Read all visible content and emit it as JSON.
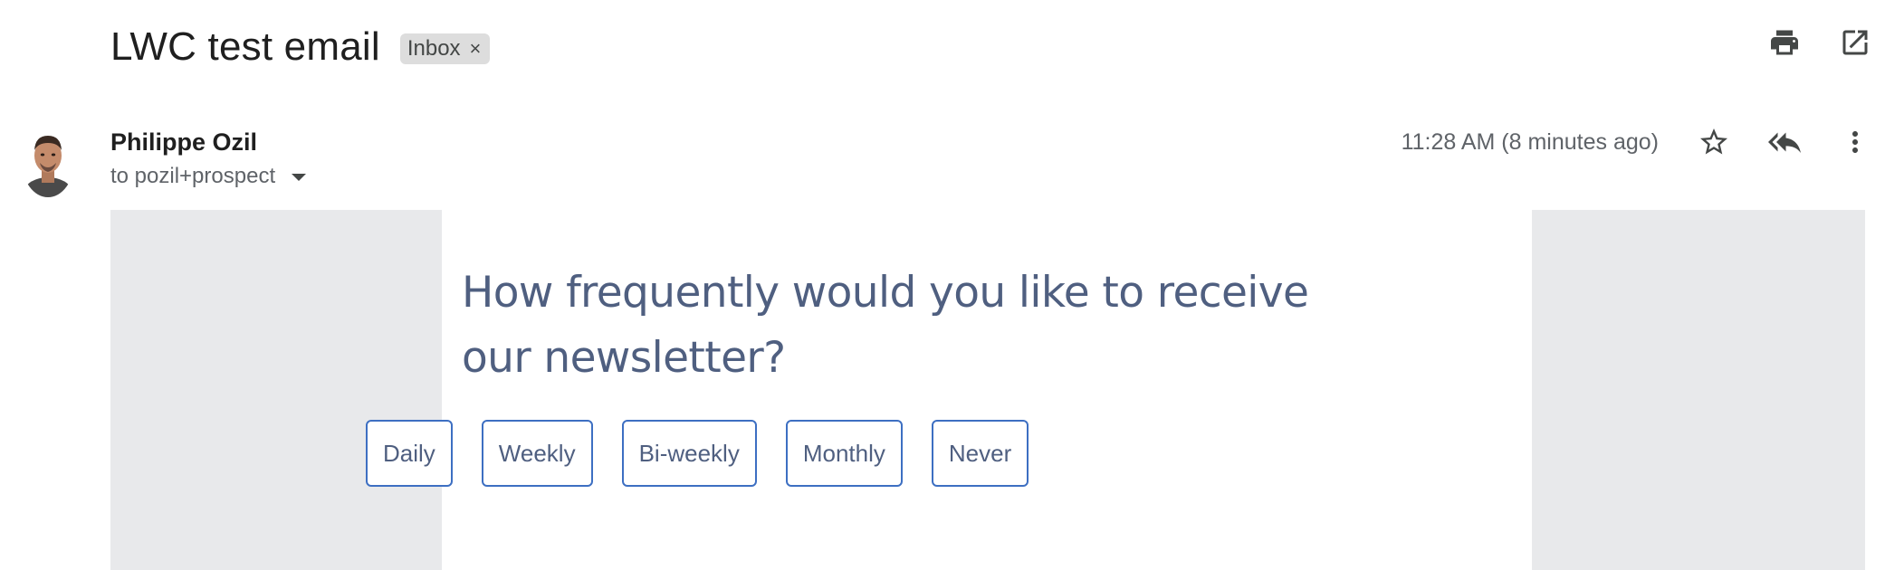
{
  "subject": {
    "title": "LWC test email",
    "label": "Inbox",
    "label_remove": "×"
  },
  "top_actions": [
    {
      "icon": "print-icon"
    },
    {
      "icon": "open-in-new-window-icon"
    }
  ],
  "sender": {
    "name": "Philippe Ozil",
    "recipient": "to pozil+prospect",
    "avatar": "avatar-photo"
  },
  "message_meta": {
    "timestamp": "11:28 AM (8 minutes ago)",
    "icons": [
      "star-icon",
      "reply-all-icon",
      "more-vert-icon"
    ]
  },
  "email_content": {
    "question": "How frequently would you like to receive our newsletter?",
    "options": [
      "Daily",
      "Weekly",
      "Bi-weekly",
      "Monthly",
      "Never"
    ]
  },
  "colors": {
    "question_text": "#4f5f80",
    "option_border": "#3d6fc2",
    "body_background": "#e8e9eb",
    "label_chip": "#dddddd"
  }
}
